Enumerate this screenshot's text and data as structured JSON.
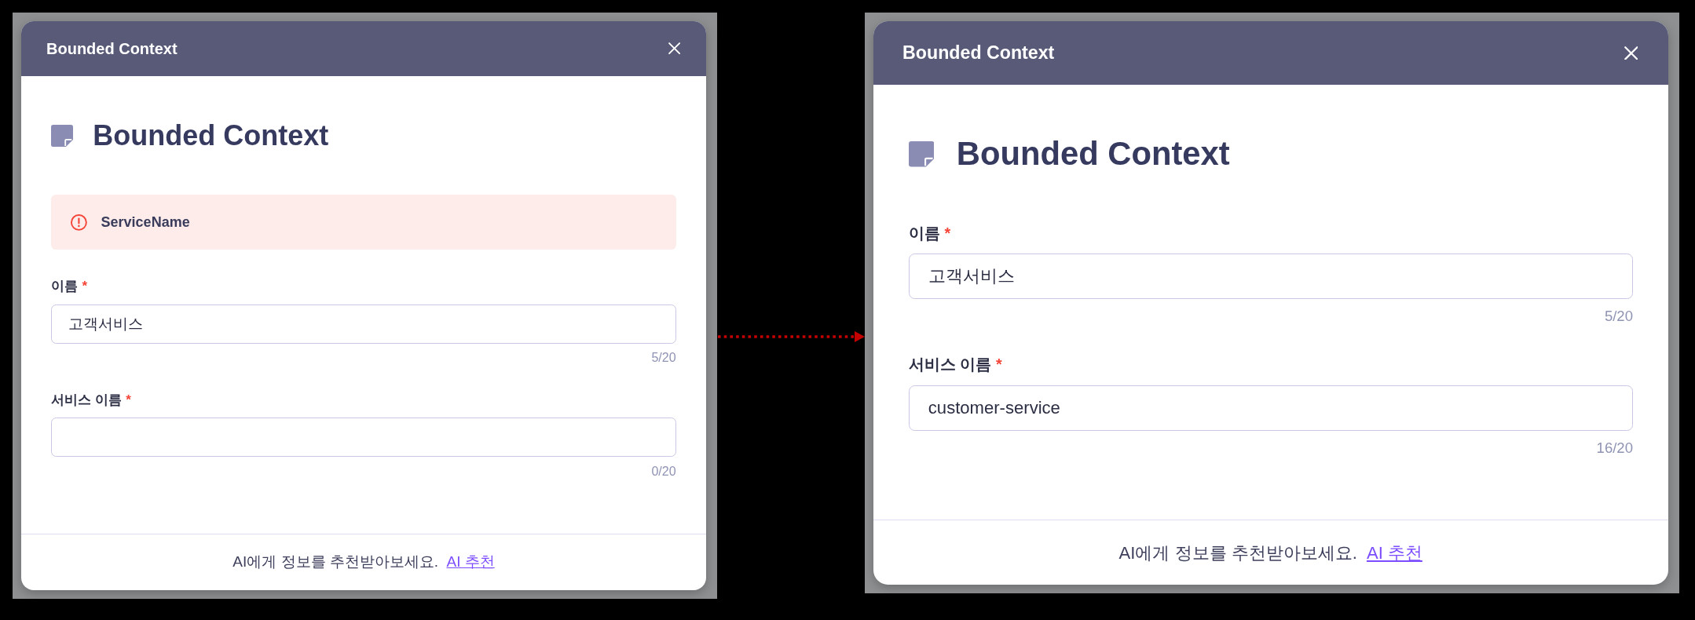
{
  "screenshots": [
    {
      "title": "Bounded Context",
      "heading": "Bounded Context",
      "alert": {
        "text": "ServiceName"
      },
      "fields": [
        {
          "label": "이름",
          "required_mark": "*",
          "value": "고객서비스",
          "counter": "5/20"
        },
        {
          "label": "서비스 이름",
          "required_mark": "*",
          "counter": "0/20"
        }
      ],
      "footer": {
        "hint": "AI에게 정보를 추천받아보세요.",
        "link": "AI 추천"
      }
    },
    {
      "title": "Bounded Context",
      "heading": "Bounded Context",
      "fields": [
        {
          "label": "이름",
          "required_mark": "*",
          "value": "고객서비스",
          "counter": "5/20"
        },
        {
          "label": "서비스 이름",
          "required_mark": "*",
          "value": "customer-service",
          "counter": "16/20"
        }
      ],
      "footer": {
        "hint": "AI에게 정보를 추천받아보세요.",
        "link": "AI 추천"
      }
    }
  ]
}
